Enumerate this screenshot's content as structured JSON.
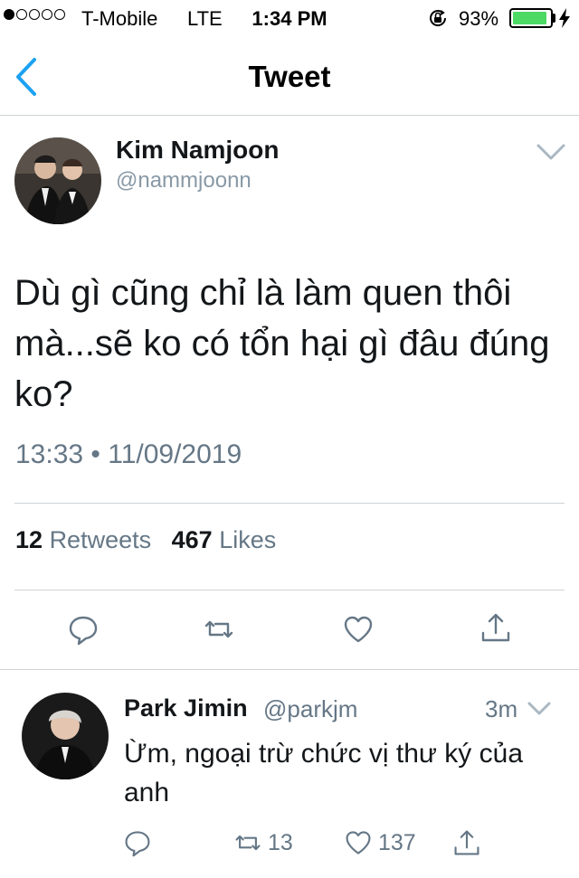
{
  "status_bar": {
    "carrier": "T-Mobile",
    "network": "LTE",
    "time": "1:34 PM",
    "battery_percent": "93%",
    "battery_level": 0.93,
    "signal_bars": 1,
    "icons": [
      "orientation-lock-icon",
      "battery-icon",
      "charging-bolt-icon"
    ]
  },
  "nav": {
    "title": "Tweet",
    "back_icon": "chevron-left-icon"
  },
  "tweet": {
    "author_name": "Kim Namjoon",
    "author_handle": "@nammjoonn",
    "text": "Dù gì cũng chỉ là làm quen thôi mà...sẽ ko có tổn hại gì đâu đúng ko?",
    "timestamp": "13:33 • 11/09/2019",
    "retweet_count": "12",
    "retweets_label": "Retweets",
    "like_count": "467",
    "likes_label": "Likes",
    "accent_color": "#1da1f2",
    "actions": [
      "reply-icon",
      "retweet-icon",
      "like-icon",
      "share-icon"
    ]
  },
  "reply": {
    "author_name": "Park Jimin",
    "author_handle": "@parkjm",
    "time_ago": "3m",
    "text": "Ừm, ngoại trừ chức vị thư ký của anh",
    "retweet_count": "13",
    "like_count": "137"
  }
}
